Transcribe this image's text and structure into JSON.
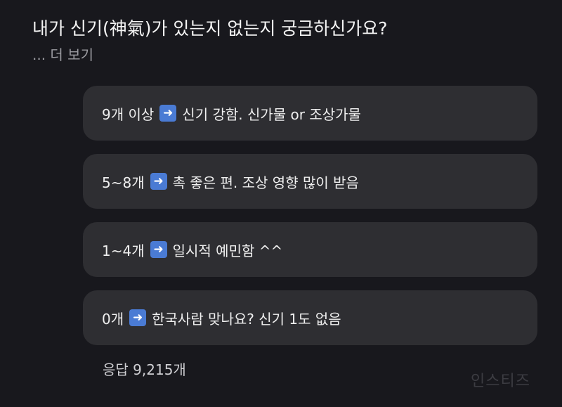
{
  "question": "내가 신기(神氣)가 있는지 없는지 궁금하신가요?",
  "more_link": "... 더 보기",
  "options": [
    {
      "before": "9개 이상",
      "after": "신기 강함. 신가물 or 조상가물",
      "arrow_icon": "right-arrow-emoji-icon"
    },
    {
      "before": "5~8개",
      "after": "촉 좋은 편. 조상 영향 많이 받음",
      "arrow_icon": "right-arrow-emoji-icon"
    },
    {
      "before": "1~4개",
      "after": "일시적 예민함 ^^",
      "arrow_icon": "right-arrow-emoji-icon"
    },
    {
      "before": "0개",
      "after": "한국사람 맞나요? 신기 1도 없음",
      "arrow_icon": "right-arrow-emoji-icon"
    }
  ],
  "response_count": "응답 9,215개",
  "watermark": "인스티즈",
  "colors": {
    "background": "#18181d",
    "option_bg": "#2e2e32",
    "arrow_bg": "#4a7bd4"
  }
}
